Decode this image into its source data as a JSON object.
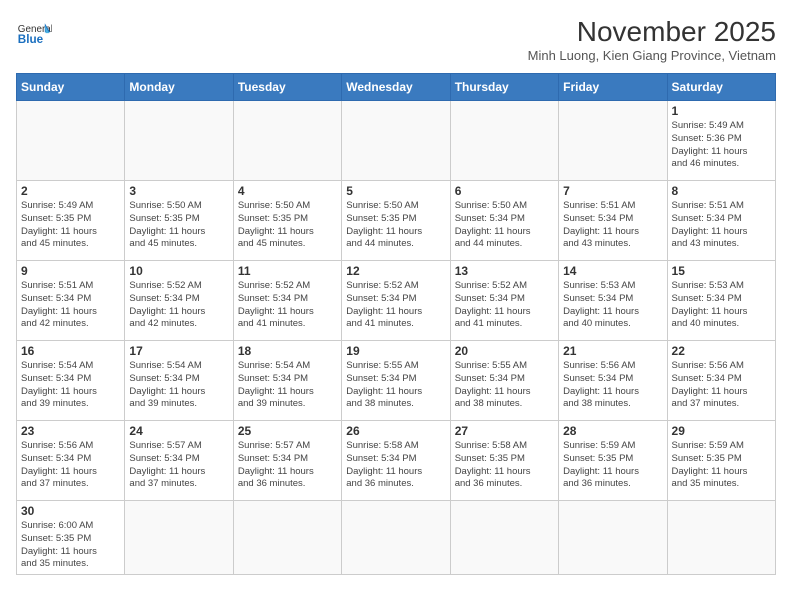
{
  "header": {
    "logo_general": "General",
    "logo_blue": "Blue",
    "title": "November 2025",
    "subtitle": "Minh Luong, Kien Giang Province, Vietnam"
  },
  "days_of_week": [
    "Sunday",
    "Monday",
    "Tuesday",
    "Wednesday",
    "Thursday",
    "Friday",
    "Saturday"
  ],
  "weeks": [
    [
      {
        "day": "",
        "info": ""
      },
      {
        "day": "",
        "info": ""
      },
      {
        "day": "",
        "info": ""
      },
      {
        "day": "",
        "info": ""
      },
      {
        "day": "",
        "info": ""
      },
      {
        "day": "",
        "info": ""
      },
      {
        "day": "1",
        "info": "Sunrise: 5:49 AM\nSunset: 5:36 PM\nDaylight: 11 hours\nand 46 minutes."
      }
    ],
    [
      {
        "day": "2",
        "info": "Sunrise: 5:49 AM\nSunset: 5:35 PM\nDaylight: 11 hours\nand 45 minutes."
      },
      {
        "day": "3",
        "info": "Sunrise: 5:50 AM\nSunset: 5:35 PM\nDaylight: 11 hours\nand 45 minutes."
      },
      {
        "day": "4",
        "info": "Sunrise: 5:50 AM\nSunset: 5:35 PM\nDaylight: 11 hours\nand 45 minutes."
      },
      {
        "day": "5",
        "info": "Sunrise: 5:50 AM\nSunset: 5:35 PM\nDaylight: 11 hours\nand 44 minutes."
      },
      {
        "day": "6",
        "info": "Sunrise: 5:50 AM\nSunset: 5:34 PM\nDaylight: 11 hours\nand 44 minutes."
      },
      {
        "day": "7",
        "info": "Sunrise: 5:51 AM\nSunset: 5:34 PM\nDaylight: 11 hours\nand 43 minutes."
      },
      {
        "day": "8",
        "info": "Sunrise: 5:51 AM\nSunset: 5:34 PM\nDaylight: 11 hours\nand 43 minutes."
      }
    ],
    [
      {
        "day": "9",
        "info": "Sunrise: 5:51 AM\nSunset: 5:34 PM\nDaylight: 11 hours\nand 42 minutes."
      },
      {
        "day": "10",
        "info": "Sunrise: 5:52 AM\nSunset: 5:34 PM\nDaylight: 11 hours\nand 42 minutes."
      },
      {
        "day": "11",
        "info": "Sunrise: 5:52 AM\nSunset: 5:34 PM\nDaylight: 11 hours\nand 41 minutes."
      },
      {
        "day": "12",
        "info": "Sunrise: 5:52 AM\nSunset: 5:34 PM\nDaylight: 11 hours\nand 41 minutes."
      },
      {
        "day": "13",
        "info": "Sunrise: 5:52 AM\nSunset: 5:34 PM\nDaylight: 11 hours\nand 41 minutes."
      },
      {
        "day": "14",
        "info": "Sunrise: 5:53 AM\nSunset: 5:34 PM\nDaylight: 11 hours\nand 40 minutes."
      },
      {
        "day": "15",
        "info": "Sunrise: 5:53 AM\nSunset: 5:34 PM\nDaylight: 11 hours\nand 40 minutes."
      }
    ],
    [
      {
        "day": "16",
        "info": "Sunrise: 5:54 AM\nSunset: 5:34 PM\nDaylight: 11 hours\nand 39 minutes."
      },
      {
        "day": "17",
        "info": "Sunrise: 5:54 AM\nSunset: 5:34 PM\nDaylight: 11 hours\nand 39 minutes."
      },
      {
        "day": "18",
        "info": "Sunrise: 5:54 AM\nSunset: 5:34 PM\nDaylight: 11 hours\nand 39 minutes."
      },
      {
        "day": "19",
        "info": "Sunrise: 5:55 AM\nSunset: 5:34 PM\nDaylight: 11 hours\nand 38 minutes."
      },
      {
        "day": "20",
        "info": "Sunrise: 5:55 AM\nSunset: 5:34 PM\nDaylight: 11 hours\nand 38 minutes."
      },
      {
        "day": "21",
        "info": "Sunrise: 5:56 AM\nSunset: 5:34 PM\nDaylight: 11 hours\nand 38 minutes."
      },
      {
        "day": "22",
        "info": "Sunrise: 5:56 AM\nSunset: 5:34 PM\nDaylight: 11 hours\nand 37 minutes."
      }
    ],
    [
      {
        "day": "23",
        "info": "Sunrise: 5:56 AM\nSunset: 5:34 PM\nDaylight: 11 hours\nand 37 minutes."
      },
      {
        "day": "24",
        "info": "Sunrise: 5:57 AM\nSunset: 5:34 PM\nDaylight: 11 hours\nand 37 minutes."
      },
      {
        "day": "25",
        "info": "Sunrise: 5:57 AM\nSunset: 5:34 PM\nDaylight: 11 hours\nand 36 minutes."
      },
      {
        "day": "26",
        "info": "Sunrise: 5:58 AM\nSunset: 5:34 PM\nDaylight: 11 hours\nand 36 minutes."
      },
      {
        "day": "27",
        "info": "Sunrise: 5:58 AM\nSunset: 5:35 PM\nDaylight: 11 hours\nand 36 minutes."
      },
      {
        "day": "28",
        "info": "Sunrise: 5:59 AM\nSunset: 5:35 PM\nDaylight: 11 hours\nand 36 minutes."
      },
      {
        "day": "29",
        "info": "Sunrise: 5:59 AM\nSunset: 5:35 PM\nDaylight: 11 hours\nand 35 minutes."
      }
    ],
    [
      {
        "day": "30",
        "info": "Sunrise: 6:00 AM\nSunset: 5:35 PM\nDaylight: 11 hours\nand 35 minutes."
      },
      {
        "day": "",
        "info": ""
      },
      {
        "day": "",
        "info": ""
      },
      {
        "day": "",
        "info": ""
      },
      {
        "day": "",
        "info": ""
      },
      {
        "day": "",
        "info": ""
      },
      {
        "day": "",
        "info": ""
      }
    ]
  ]
}
